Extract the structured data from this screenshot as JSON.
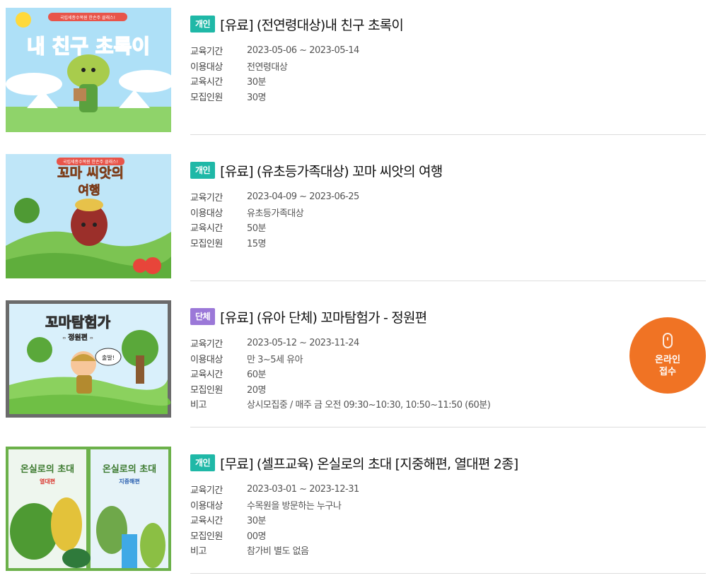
{
  "labels": {
    "period": "교육기간",
    "target": "이용대상",
    "duration": "교육시간",
    "capacity": "모집인원",
    "note": "비고"
  },
  "programs": [
    {
      "badge": "개인",
      "title": "[유료] (전연령대상)내 친구 초록이",
      "period": "2023-05-06 ~ 2023-05-14",
      "target": "전연령대상",
      "duration": "30분",
      "capacity": "30명",
      "thumb": {
        "top_caption": "국립세종수목원 한손주 클래스!",
        "heading": "내 친구 초록이"
      }
    },
    {
      "badge": "개인",
      "title": "[유료] (유초등가족대상) 꼬마 씨앗의 여행",
      "period": "2023-04-09 ~ 2023-06-25",
      "target": "유초등가족대상",
      "duration": "50분",
      "capacity": "15명",
      "thumb": {
        "top_caption": "국립세종수목원 한손주 클래스!",
        "heading_1": "꼬마 씨앗의",
        "heading_2": "여행"
      }
    },
    {
      "badge": "단체",
      "title": "[유료] (유아 단체) 꼬마탐험가 - 정원편",
      "period": "2023-05-12 ~ 2023-11-24",
      "target": "만 3~5세 유아",
      "duration": "60분",
      "capacity": "20명",
      "note": "상시모집중 / 매주 금 오전 09:30~10:30, 10:50~11:50 (60분)",
      "thumb": {
        "heading": "꼬마탐험가",
        "subheading": "- 정원편 -",
        "bubble": "출발!"
      }
    },
    {
      "badge": "개인",
      "title": "[무료] (셀프교육) 온실로의 초대 [지중해편, 열대편 2종]",
      "period": "2023-03-01 ~ 2023-12-31",
      "target": "수목원을 방문하는 누구나",
      "duration": "30분",
      "capacity": "00명",
      "note": "참가비 별도 없음",
      "thumb": {
        "left_title": "온실로의 초대",
        "left_sub": "열대편",
        "right_title": "온실로의 초대",
        "right_sub": "지중해편"
      }
    }
  ],
  "apply_button": {
    "label_1": "온라인",
    "label_2": "접수",
    "icon": "mouse-icon"
  },
  "colors": {
    "badge_personal": "#1fb8a7",
    "badge_group": "#9b78d8",
    "apply_button": "#f07324",
    "divider": "#dddddd"
  }
}
